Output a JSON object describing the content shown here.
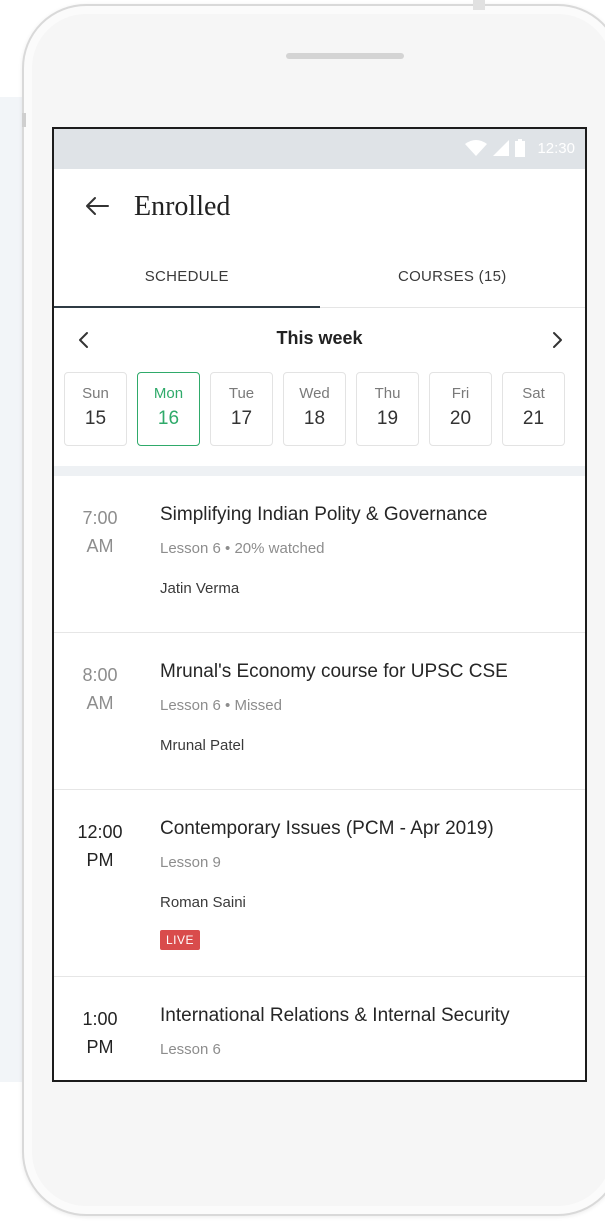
{
  "status_bar": {
    "time": "12:30"
  },
  "app_bar": {
    "title": "Enrolled"
  },
  "tabs": [
    {
      "label": "SCHEDULE",
      "active": true
    },
    {
      "label": "COURSES (15)",
      "active": false
    }
  ],
  "week": {
    "label": "This week",
    "days": [
      {
        "name": "Sun",
        "date": "15",
        "selected": false
      },
      {
        "name": "Mon",
        "date": "16",
        "selected": true
      },
      {
        "name": "Tue",
        "date": "17",
        "selected": false
      },
      {
        "name": "Wed",
        "date": "18",
        "selected": false
      },
      {
        "name": "Thu",
        "date": "19",
        "selected": false
      },
      {
        "name": "Fri",
        "date": "20",
        "selected": false
      },
      {
        "name": "Sat",
        "date": "21",
        "selected": false
      }
    ]
  },
  "sessions": [
    {
      "time": "7:00",
      "period": "AM",
      "title": "Simplifying Indian Polity & Governance",
      "subtitle": "Lesson 6  •  20% watched",
      "author": "Jatin Verma"
    },
    {
      "time": "8:00",
      "period": "AM",
      "title": "Mrunal's Economy course for UPSC CSE",
      "subtitle": "Lesson 6  •  Missed",
      "author": "Mrunal Patel"
    },
    {
      "time": "12:00",
      "period": "PM",
      "title": "Contemporary Issues (PCM - Apr 2019)",
      "subtitle": "Lesson 9",
      "author": "Roman Saini",
      "badge": "LIVE"
    },
    {
      "time": "1:00",
      "period": "PM",
      "title": "International Relations & Internal Security",
      "subtitle": "Lesson 6"
    }
  ],
  "colors": {
    "accent_green": "#2faa6a",
    "live_red": "#d94c4c",
    "tab_indicator": "#2f3b44"
  }
}
